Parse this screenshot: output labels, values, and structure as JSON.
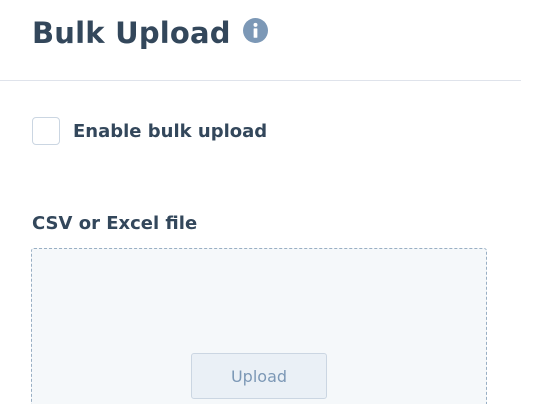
{
  "header": {
    "title": "Bulk Upload",
    "info_icon": "info-icon"
  },
  "bulk_upload": {
    "checkbox_label": "Enable bulk upload",
    "checked": false
  },
  "file_field": {
    "label": "CSV or Excel file",
    "upload_button_label": "Upload",
    "upload_disabled": true
  },
  "colors": {
    "text": "#33475b",
    "info_icon": "#7c98b6",
    "divider": "#dfe3eb",
    "dropzone_border": "#99afc4",
    "dropzone_bg": "#f5f8fa",
    "button_bg": "#eaf0f6",
    "button_text": "#7c98b6"
  }
}
